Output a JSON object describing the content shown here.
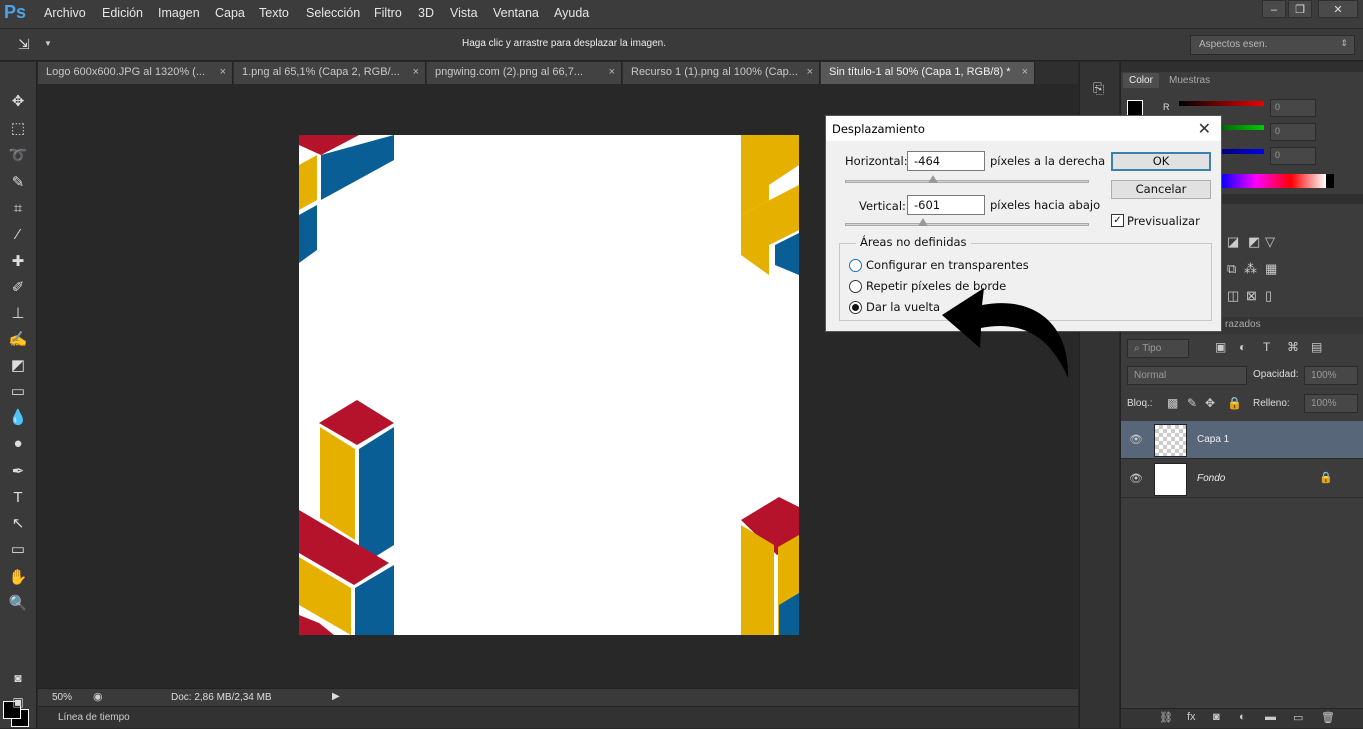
{
  "app": {
    "logo": "Ps"
  },
  "menu": [
    "Archivo",
    "Edición",
    "Imagen",
    "Capa",
    "Texto",
    "Selección",
    "Filtro",
    "3D",
    "Vista",
    "Ventana",
    "Ayuda"
  ],
  "window_controls": {
    "minimize": "–",
    "restore": "❐",
    "close": "✕"
  },
  "options_bar": {
    "hint": "Haga clic y arrastre para desplazar la imagen.",
    "workspace": "Aspectos esen."
  },
  "tabs": [
    {
      "label": "Logo 600x600.JPG al 1320% (..."
    },
    {
      "label": "1.png al 65,1% (Capa 2, RGB/..."
    },
    {
      "label": "pngwing.com (2).png al 66,7..."
    },
    {
      "label": "Recurso 1 (1).png al 100% (Cap..."
    },
    {
      "label": "Sin título-1 al 50% (Capa 1, RGB/8) *"
    }
  ],
  "tab_close": "×",
  "status": {
    "zoom": "50%",
    "doc": "Doc: 2,86 MB/2,34 MB"
  },
  "timeline": {
    "label": "Línea de tiempo"
  },
  "color_panel": {
    "tabs": [
      "Color",
      "Muestras"
    ],
    "channel_labels": [
      "R"
    ],
    "values": [
      "0",
      "0",
      "0"
    ]
  },
  "layers_panel": {
    "tab_fragment": "razados",
    "filter": "Tipo",
    "blend_mode": "Normal",
    "opacity_label": "Opacidad:",
    "opacity_value": "100%",
    "lock_label": "Bloq.:",
    "fill_label": "Relleno:",
    "fill_value": "100%",
    "layers": [
      {
        "name": "Capa 1",
        "selected": true
      },
      {
        "name": "Fondo",
        "selected": false,
        "locked": true
      }
    ]
  },
  "dialog": {
    "title": "Desplazamiento",
    "horizontal_label": "Horizontal:",
    "horizontal_value": "-464",
    "horizontal_unit": "píxeles a la derecha",
    "vertical_label": "Vertical:",
    "vertical_value": "-601",
    "vertical_unit": "píxeles hacia abajo",
    "ok": "OK",
    "cancel": "Cancelar",
    "preview": "Previsualizar",
    "preview_checked": true,
    "group_label": "Áreas no definidas",
    "options": [
      {
        "label": "Configurar en transparentes",
        "selected": false
      },
      {
        "label": "Repetir píxeles de borde",
        "selected": false
      },
      {
        "label": "Dar la vuelta",
        "selected": true
      }
    ]
  },
  "colors": {
    "red": "#b5122b",
    "yellow": "#e5b000",
    "blue": "#0a5e96",
    "accent": "#4aa3e8"
  }
}
